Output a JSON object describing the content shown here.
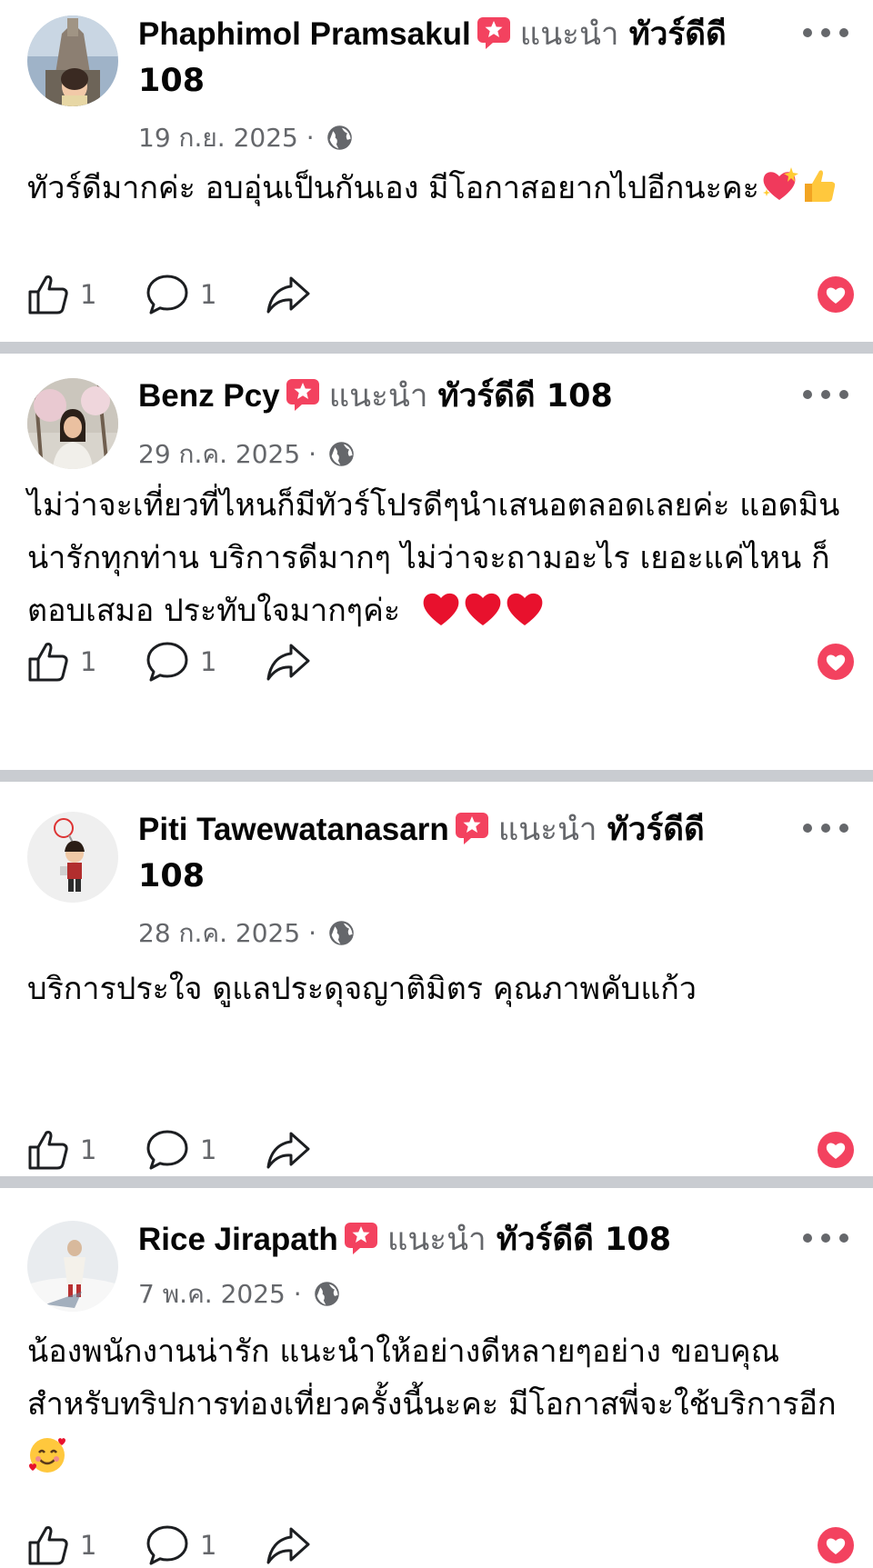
{
  "reviews": [
    {
      "author": "Phaphimol Pramsakul",
      "recommends_label": "แนะนำ",
      "page_name": "ทัวร์ดีดี 108",
      "date": "19 ก.ย. 2025",
      "separator": "·",
      "text": "ทัวร์ดีมากค่ะ อบอุ่นเป็นกันเอง มีโอกาสอยากไปอีกนะคะ",
      "emojis": [
        "sparkling-heart",
        "thumbs-up"
      ],
      "like_count": "1",
      "comment_count": "1"
    },
    {
      "author": "Benz Pcy",
      "recommends_label": "แนะนำ",
      "page_name": "ทัวร์ดีดี 108",
      "date": "29 ก.ค. 2025",
      "separator": "·",
      "text": "ไม่ว่าจะเที่ยวที่ไหนก็มีทัวร์โปรดีๆนำเสนอตลอดเลยค่ะ แอดมินน่ารักทุกท่าน บริการดีมากๆ ไม่ว่าจะถามอะไร เยอะแค่ไหน ก็ตอบเสมอ ประทับใจมากๆค่ะ",
      "emojis": [
        "red-heart",
        "red-heart",
        "red-heart"
      ],
      "like_count": "1",
      "comment_count": "1"
    },
    {
      "author": "Piti Tawewatanasarn",
      "recommends_label": "แนะนำ",
      "page_name": "ทัวร์ดีดี 108",
      "date": "28 ก.ค. 2025",
      "separator": "·",
      "text": "บริการประใจ ดูแลประดุจญาติมิตร คุณภาพคับแก้ว",
      "emojis": [],
      "like_count": "1",
      "comment_count": "1"
    },
    {
      "author": "Rice Jirapath",
      "recommends_label": "แนะนำ",
      "page_name": "ทัวร์ดีดี 108",
      "date": "7 พ.ค. 2025",
      "separator": "·",
      "text": "น้องพนักงานน่ารัก แนะนำให้อย่างดีหลายๆอย่าง ขอบคุณสำหรับทริปการท่องเที่ยวครั้งนี้นะคะ มีโอกาสพี่จะใช้บริการอีก",
      "emojis": [
        "smiling-face-with-hearts"
      ],
      "like_count": "1",
      "comment_count": "1"
    }
  ],
  "icons": {
    "recommend_badge": "recommend-badge-icon",
    "audience": "globe-icon",
    "more": "more-options-icon",
    "like": "thumbs-up-icon",
    "comment": "comment-icon",
    "share": "share-icon",
    "react": "heart-icon"
  },
  "colors": {
    "badge_pink": "#f3425f",
    "secondary_text": "#65676b",
    "divider": "#c9ccd1",
    "heart_red": "#f3425f"
  }
}
